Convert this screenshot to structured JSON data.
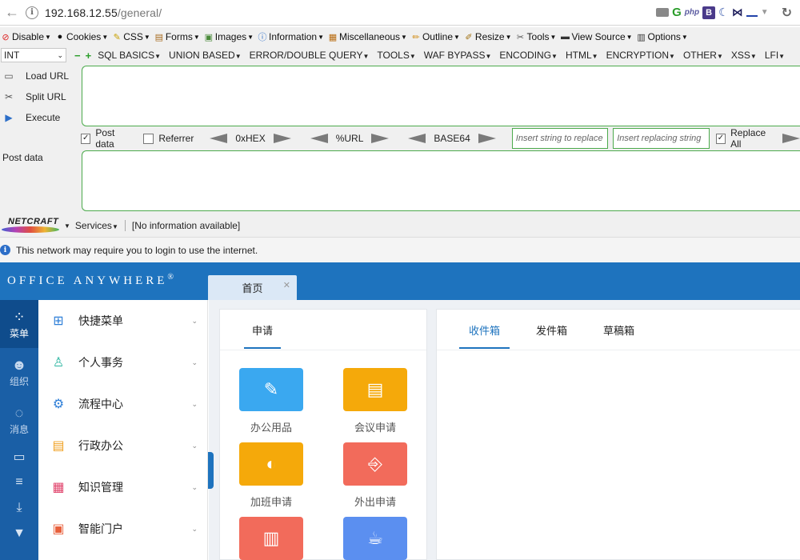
{
  "browser": {
    "url_host": "192.168.12.55",
    "url_path": "/general/",
    "ext_php": "php",
    "ext_b": "B"
  },
  "hackbar": {
    "menus": [
      {
        "label": "Disable",
        "icon": "disable-icon"
      },
      {
        "label": "Cookies",
        "icon": "user-icon"
      },
      {
        "label": "CSS",
        "icon": "wand-icon"
      },
      {
        "label": "Forms",
        "icon": "forms-icon"
      },
      {
        "label": "Images",
        "icon": "images-icon"
      },
      {
        "label": "Information",
        "icon": "info-icon"
      },
      {
        "label": "Miscellaneous",
        "icon": "misc-icon"
      },
      {
        "label": "Outline",
        "icon": "pencil-icon"
      },
      {
        "label": "Resize",
        "icon": "resize-icon"
      },
      {
        "label": "Tools",
        "icon": "tools-icon"
      },
      {
        "label": "View Source",
        "icon": "source-icon"
      },
      {
        "label": "Options",
        "icon": "options-icon"
      }
    ],
    "type_select": "INT",
    "toolbar": [
      "SQL BASICS",
      "UNION BASED",
      "ERROR/DOUBLE QUERY",
      "TOOLS",
      "WAF BYPASS",
      "ENCODING",
      "HTML",
      "ENCRYPTION",
      "OTHER",
      "XSS",
      "LFI"
    ],
    "actions": [
      "Load URL",
      "Split URL",
      "Execute"
    ],
    "url_value": "",
    "post_data_checkbox": "Post data",
    "referrer_checkbox": "Referrer",
    "encoders": [
      "0xHEX",
      "%URL",
      "BASE64"
    ],
    "replace_placeholder": "Insert string to replace",
    "replacing_placeholder": "Insert replacing string",
    "replace_all": "Replace All",
    "post_data_label": "Post data",
    "post_data_value": ""
  },
  "netcraft": {
    "logo": "NETCRAFT",
    "services": "Services",
    "info": "[No information available]"
  },
  "notification": {
    "text": "This network may require you to login to use the internet."
  },
  "app": {
    "brand": "Office Anywhere",
    "brand_mark": "®",
    "home_tab": "首页",
    "iconbar": [
      {
        "label": "菜单",
        "icon": "grid-icon",
        "active": true
      },
      {
        "label": "组织",
        "icon": "people-icon",
        "active": false
      },
      {
        "label": "消息",
        "icon": "chat-icon",
        "active": false
      }
    ],
    "iconbar_small": [
      "monitor-icon",
      "server-icon",
      "download-icon",
      "shirt-icon"
    ],
    "menu": [
      {
        "label": "快捷菜单",
        "icon": "shortcut-icon",
        "color": "#2f7fd8"
      },
      {
        "label": "个人事务",
        "icon": "person-icon",
        "color": "#2bb5a0"
      },
      {
        "label": "流程中心",
        "icon": "workflow-icon",
        "color": "#2f7fd8"
      },
      {
        "label": "行政办公",
        "icon": "briefcase-icon",
        "color": "#f0a020"
      },
      {
        "label": "知识管理",
        "icon": "book-icon",
        "color": "#e0416a"
      },
      {
        "label": "智能门户",
        "icon": "portal-icon",
        "color": "#e8603c"
      }
    ],
    "left_panel_tab": "申请",
    "tiles": [
      {
        "label": "办公用品",
        "icon": "notebook-icon",
        "color": "#3aa8f0"
      },
      {
        "label": "会议申请",
        "icon": "presentation-icon",
        "color": "#f5a90a"
      },
      {
        "label": "加班申请",
        "icon": "moon-icon",
        "color": "#f5a90a"
      },
      {
        "label": "外出申请",
        "icon": "door-icon",
        "color": "#f26b5b"
      },
      {
        "label": "",
        "icon": "luggage-icon",
        "color": "#f26b5b"
      },
      {
        "label": "",
        "icon": "coffee-icon",
        "color": "#5b8ff0"
      }
    ],
    "right_tabs": [
      "收件箱",
      "发件箱",
      "草稿箱"
    ]
  }
}
